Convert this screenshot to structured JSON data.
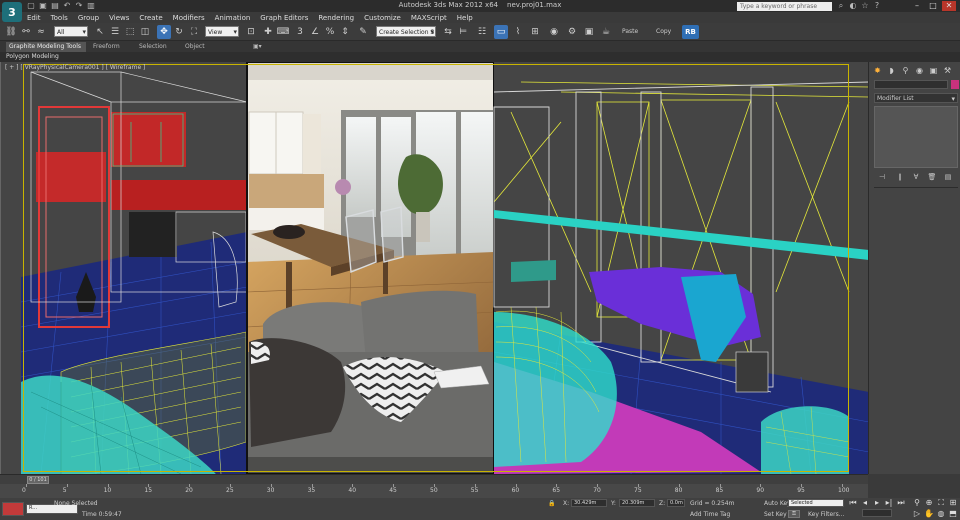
{
  "titlebar": {
    "app_title": "Autodesk 3ds Max 2012 x64",
    "file_name": "nev.proj01.max",
    "search_placeholder": "Type a keyword or phrase",
    "app_logo": "3"
  },
  "menu": [
    "Edit",
    "Tools",
    "Group",
    "Views",
    "Create",
    "Modifiers",
    "Animation",
    "Graph Editors",
    "Rendering",
    "Customize",
    "MAXScript",
    "Help"
  ],
  "toolbar": {
    "filter_value": "All",
    "coord_value": "View",
    "selection_set_value": "Create Selection S",
    "paste_label": "Paste",
    "copy_label": "Copy",
    "rb_label": "RB"
  },
  "ribbon": {
    "tabs": [
      "Graphite Modeling Tools",
      "Freeform",
      "Selection",
      "Object Paint"
    ],
    "active_panel": "Polygon Modeling"
  },
  "viewport": {
    "label": "[ + ] [ VRayPhysicalCamera001 ] [ Wireframe ]",
    "frame_color": "#c8b400",
    "render_colors": {
      "wall": "#e8e3d8",
      "floor": "#b98a4a",
      "sofa": "#6b6b6b"
    },
    "wire_colors": {
      "yellow": "#e4e83a",
      "cyan": "#3cd6c8",
      "red": "#d83a3a",
      "blue": "#2a3aa0",
      "purple": "#7a2fd6",
      "magenta": "#c23ab8",
      "white": "#d8d8d8"
    }
  },
  "command_panel": {
    "modifier_list_label": "Modifier List",
    "object_color": "#c8327d"
  },
  "timeline": {
    "slider_label": "0 / 101",
    "ticks": [
      0,
      5,
      10,
      15,
      20,
      25,
      30,
      35,
      40,
      45,
      50,
      55,
      60,
      65,
      70,
      75,
      80,
      85,
      90,
      95,
      100
    ]
  },
  "statusbar": {
    "selection_info": "None Selected",
    "time_info": "Time 0:59:47",
    "x_label": "X:",
    "x_value": "30.429m",
    "y_label": "Y:",
    "y_value": "20.309m",
    "z_label": "Z:",
    "z_value": "0.0m",
    "grid_label": "Grid = 0.254m",
    "add_time_tag": "Add Time Tag",
    "auto_key": "Auto Key",
    "set_key": "Set Key",
    "selected_dropdown": "Selected",
    "key_filters": "Key Filters...",
    "left_field": "R..."
  }
}
